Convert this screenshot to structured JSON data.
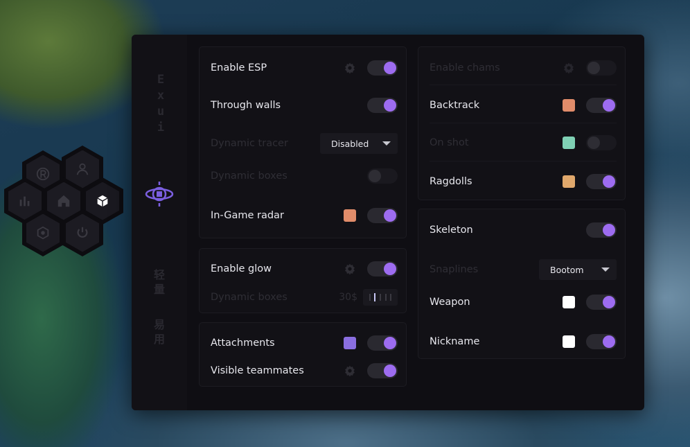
{
  "sidebar": {
    "brand": "Exui",
    "vertical_text_1": "轻量",
    "vertical_text_2": "易用"
  },
  "hex_menu": [
    "r-logo-icon",
    "user-icon",
    "chart-icon",
    "home-icon",
    "cube-icon",
    "target-icon",
    "power-icon"
  ],
  "panel_esp": {
    "enable_esp": {
      "label": "Enable ESP",
      "on": true
    },
    "through_walls": {
      "label": "Through walls",
      "on": true
    },
    "dynamic_tracer": {
      "label": "Dynamic tracer",
      "value": "Disabled"
    },
    "dynamic_boxes": {
      "label": "Dynamic boxes",
      "on": false
    },
    "ingame_radar": {
      "label": "In-Game radar",
      "color": "#e18c6a",
      "on": true
    }
  },
  "panel_glow": {
    "enable_glow": {
      "label": "Enable glow",
      "on": true
    },
    "dynamic_boxes": {
      "label": "Dynamic boxes",
      "value": "30$"
    }
  },
  "panel_extra": {
    "attachments": {
      "label": "Attachments",
      "color": "#8a6ee0",
      "on": true
    },
    "visible_teammates": {
      "label": "Visible teammates",
      "on": true
    }
  },
  "panel_chams": {
    "enable_chams": {
      "label": "Enable chams",
      "on": false
    },
    "backtrack": {
      "label": "Backtrack",
      "color": "#e18c6a",
      "on": true
    },
    "on_shot": {
      "label": "On shot",
      "color": "#7fd0b4",
      "on": false
    },
    "ragdolls": {
      "label": "Ragdolls",
      "color": "#e0a86c",
      "on": true
    }
  },
  "panel_skeleton": {
    "skeleton": {
      "label": "Skeleton",
      "on": true
    },
    "snaplines": {
      "label": "Snaplines",
      "value": "Bootom"
    },
    "weapon": {
      "label": "Weapon",
      "color": "#ffffff",
      "on": true
    },
    "nickname": {
      "label": "Nickname",
      "color": "#ffffff",
      "on": true
    }
  },
  "colors": {
    "accent": "#9d6cf0",
    "window_bg": "#0f0e13"
  }
}
